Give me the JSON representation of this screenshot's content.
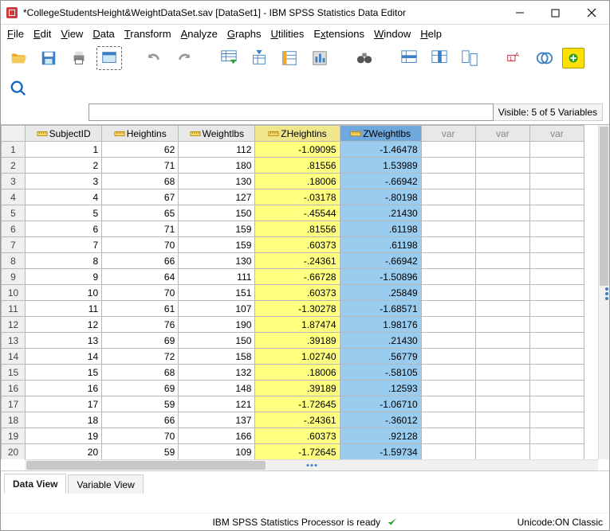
{
  "window": {
    "title": "*CollegeStudentsHeight&WeightDataSet.sav [DataSet1] - IBM SPSS Statistics Data Editor"
  },
  "menus": {
    "file": "File",
    "edit": "Edit",
    "view": "View",
    "data": "Data",
    "transform": "Transform",
    "analyze": "Analyze",
    "graphs": "Graphs",
    "utilities": "Utilities",
    "extensions": "Extensions",
    "window": "Window",
    "help": "Help"
  },
  "visible_label": "Visible: 5 of 5 Variables",
  "columns": [
    {
      "name": "SubjectID",
      "selected": null
    },
    {
      "name": "Heightins",
      "selected": null
    },
    {
      "name": "Weightlbs",
      "selected": null
    },
    {
      "name": "ZHeightins",
      "selected": "yellow"
    },
    {
      "name": "ZWeightlbs",
      "selected": "blue"
    }
  ],
  "empty_var_label": "var",
  "rows": [
    {
      "n": 1,
      "SubjectID": "1",
      "Heightins": "62",
      "Weightlbs": "112",
      "ZHeightins": "-1.09095",
      "ZWeightlbs": "-1.46478"
    },
    {
      "n": 2,
      "SubjectID": "2",
      "Heightins": "71",
      "Weightlbs": "180",
      "ZHeightins": ".81556",
      "ZWeightlbs": "1.53989"
    },
    {
      "n": 3,
      "SubjectID": "3",
      "Heightins": "68",
      "Weightlbs": "130",
      "ZHeightins": ".18006",
      "ZWeightlbs": "-.66942"
    },
    {
      "n": 4,
      "SubjectID": "4",
      "Heightins": "67",
      "Weightlbs": "127",
      "ZHeightins": "-.03178",
      "ZWeightlbs": "-.80198"
    },
    {
      "n": 5,
      "SubjectID": "5",
      "Heightins": "65",
      "Weightlbs": "150",
      "ZHeightins": "-.45544",
      "ZWeightlbs": ".21430"
    },
    {
      "n": 6,
      "SubjectID": "6",
      "Heightins": "71",
      "Weightlbs": "159",
      "ZHeightins": ".81556",
      "ZWeightlbs": ".61198"
    },
    {
      "n": 7,
      "SubjectID": "7",
      "Heightins": "70",
      "Weightlbs": "159",
      "ZHeightins": ".60373",
      "ZWeightlbs": ".61198"
    },
    {
      "n": 8,
      "SubjectID": "8",
      "Heightins": "66",
      "Weightlbs": "130",
      "ZHeightins": "-.24361",
      "ZWeightlbs": "-.66942"
    },
    {
      "n": 9,
      "SubjectID": "9",
      "Heightins": "64",
      "Weightlbs": "111",
      "ZHeightins": "-.66728",
      "ZWeightlbs": "-1.50896"
    },
    {
      "n": 10,
      "SubjectID": "10",
      "Heightins": "70",
      "Weightlbs": "151",
      "ZHeightins": ".60373",
      "ZWeightlbs": ".25849"
    },
    {
      "n": 11,
      "SubjectID": "11",
      "Heightins": "61",
      "Weightlbs": "107",
      "ZHeightins": "-1.30278",
      "ZWeightlbs": "-1.68571"
    },
    {
      "n": 12,
      "SubjectID": "12",
      "Heightins": "76",
      "Weightlbs": "190",
      "ZHeightins": "1.87474",
      "ZWeightlbs": "1.98176"
    },
    {
      "n": 13,
      "SubjectID": "13",
      "Heightins": "69",
      "Weightlbs": "150",
      "ZHeightins": ".39189",
      "ZWeightlbs": ".21430"
    },
    {
      "n": 14,
      "SubjectID": "14",
      "Heightins": "72",
      "Weightlbs": "158",
      "ZHeightins": "1.02740",
      "ZWeightlbs": ".56779"
    },
    {
      "n": 15,
      "SubjectID": "15",
      "Heightins": "68",
      "Weightlbs": "132",
      "ZHeightins": ".18006",
      "ZWeightlbs": "-.58105"
    },
    {
      "n": 16,
      "SubjectID": "16",
      "Heightins": "69",
      "Weightlbs": "148",
      "ZHeightins": ".39189",
      "ZWeightlbs": ".12593"
    },
    {
      "n": 17,
      "SubjectID": "17",
      "Heightins": "59",
      "Weightlbs": "121",
      "ZHeightins": "-1.72645",
      "ZWeightlbs": "-1.06710"
    },
    {
      "n": 18,
      "SubjectID": "18",
      "Heightins": "66",
      "Weightlbs": "137",
      "ZHeightins": "-.24361",
      "ZWeightlbs": "-.36012"
    },
    {
      "n": 19,
      "SubjectID": "19",
      "Heightins": "70",
      "Weightlbs": "166",
      "ZHeightins": ".60373",
      "ZWeightlbs": ".92128"
    },
    {
      "n": 20,
      "SubjectID": "20",
      "Heightins": "59",
      "Weightlbs": "109",
      "ZHeightins": "-1.72645",
      "ZWeightlbs": "-1.59734"
    }
  ],
  "tabs": {
    "data_view": "Data View",
    "variable_view": "Variable View",
    "active": "data_view"
  },
  "status": {
    "center": "IBM SPSS Statistics Processor is ready",
    "right": "Unicode:ON Classic"
  }
}
